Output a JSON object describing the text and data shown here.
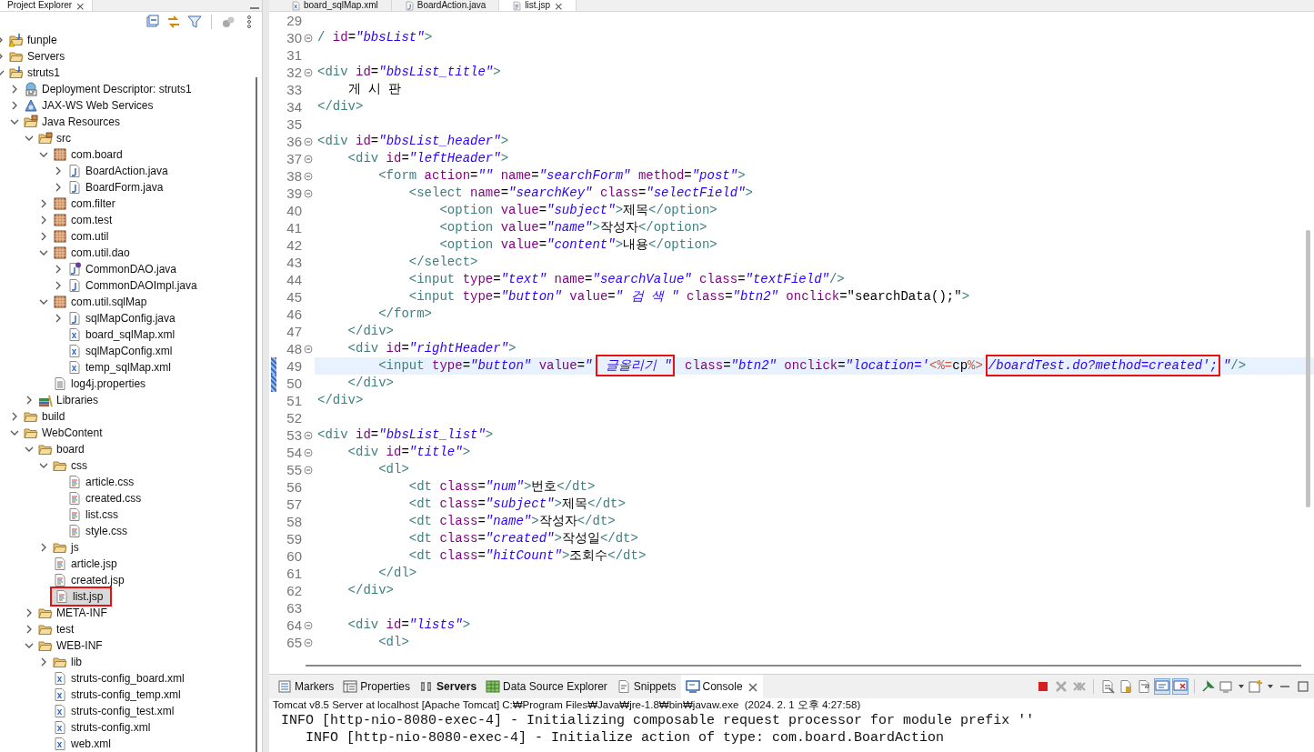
{
  "explorer": {
    "tab": {
      "label": "Project Explorer",
      "selected": true
    },
    "tree": [
      {
        "label": "funple",
        "kind": "project-warn",
        "expanded": false,
        "selected": false
      },
      {
        "label": "Servers",
        "kind": "folder",
        "expanded": false,
        "selected": false
      },
      {
        "label": "struts1",
        "kind": "project",
        "expanded": true,
        "selected": false,
        "children": [
          {
            "label": "Deployment Descriptor: struts1",
            "kind": "descriptor",
            "expanded": false,
            "selected": false
          },
          {
            "label": "JAX-WS Web Services",
            "kind": "webservice",
            "expanded": false,
            "selected": false
          },
          {
            "label": "Java Resources",
            "kind": "resources",
            "expanded": true,
            "selected": false,
            "children": [
              {
                "label": "src",
                "kind": "srcfolder",
                "expanded": true,
                "selected": false,
                "children": [
                  {
                    "label": "com.board",
                    "kind": "package",
                    "expanded": true,
                    "selected": false,
                    "children": [
                      {
                        "label": "BoardAction.java",
                        "kind": "java",
                        "expanded": false,
                        "selected": false
                      },
                      {
                        "label": "BoardForm.java",
                        "kind": "java",
                        "expanded": false,
                        "selected": false
                      }
                    ]
                  },
                  {
                    "label": "com.filter",
                    "kind": "package",
                    "expanded": false,
                    "selected": false
                  },
                  {
                    "label": "com.test",
                    "kind": "package",
                    "expanded": false,
                    "selected": false
                  },
                  {
                    "label": "com.util",
                    "kind": "package",
                    "expanded": false,
                    "selected": false
                  },
                  {
                    "label": "com.util.dao",
                    "kind": "package",
                    "expanded": true,
                    "selected": false,
                    "children": [
                      {
                        "label": "CommonDAO.java",
                        "kind": "interface",
                        "expanded": false,
                        "selected": false
                      },
                      {
                        "label": "CommonDAOImpl.java",
                        "kind": "java",
                        "expanded": false,
                        "selected": false
                      }
                    ]
                  },
                  {
                    "label": "com.util.sqlMap",
                    "kind": "package",
                    "expanded": true,
                    "selected": false,
                    "children": [
                      {
                        "label": "sqlMapConfig.java",
                        "kind": "java",
                        "expanded": false,
                        "selected": false
                      },
                      {
                        "label": "board_sqlMap.xml",
                        "kind": "xml",
                        "selected": false
                      },
                      {
                        "label": "sqlMapConfig.xml",
                        "kind": "xml",
                        "selected": false
                      },
                      {
                        "label": "temp_sqlMap.xml",
                        "kind": "xml",
                        "selected": false
                      }
                    ]
                  },
                  {
                    "label": "log4j.properties",
                    "kind": "text",
                    "selected": false
                  }
                ]
              },
              {
                "label": "Libraries",
                "kind": "library",
                "expanded": false,
                "selected": false
              }
            ]
          },
          {
            "label": "build",
            "kind": "folder",
            "expanded": false,
            "selected": false
          },
          {
            "label": "WebContent",
            "kind": "folder",
            "expanded": true,
            "selected": false,
            "children": [
              {
                "label": "board",
                "kind": "folder",
                "expanded": true,
                "selected": false,
                "children": [
                  {
                    "label": "css",
                    "kind": "folder",
                    "expanded": true,
                    "selected": false,
                    "children": [
                      {
                        "label": "article.css",
                        "kind": "web",
                        "selected": false
                      },
                      {
                        "label": "created.css",
                        "kind": "web",
                        "selected": false
                      },
                      {
                        "label": "list.css",
                        "kind": "web",
                        "selected": false
                      },
                      {
                        "label": "style.css",
                        "kind": "web",
                        "selected": false
                      }
                    ]
                  },
                  {
                    "label": "js",
                    "kind": "folder",
                    "expanded": false,
                    "selected": false
                  },
                  {
                    "label": "article.jsp",
                    "kind": "web",
                    "selected": false
                  },
                  {
                    "label": "created.jsp",
                    "kind": "web",
                    "selected": false
                  },
                  {
                    "label": "list.jsp",
                    "kind": "web",
                    "selected": true,
                    "boxed": true
                  }
                ]
              },
              {
                "label": "META-INF",
                "kind": "folder",
                "expanded": false,
                "selected": false
              },
              {
                "label": "test",
                "kind": "folder",
                "expanded": false,
                "selected": false
              },
              {
                "label": "WEB-INF",
                "kind": "folder",
                "expanded": true,
                "selected": false,
                "children": [
                  {
                    "label": "lib",
                    "kind": "folder",
                    "expanded": false,
                    "selected": false
                  },
                  {
                    "label": "struts-config_board.xml",
                    "kind": "xml",
                    "selected": false
                  },
                  {
                    "label": "struts-config_temp.xml",
                    "kind": "xml",
                    "selected": false
                  },
                  {
                    "label": "struts-config_test.xml",
                    "kind": "xml",
                    "selected": false
                  },
                  {
                    "label": "struts-config.xml",
                    "kind": "xml",
                    "selected": false
                  },
                  {
                    "label": "web.xml",
                    "kind": "xml",
                    "selected": false
                  }
                ]
              }
            ]
          }
        ]
      }
    ]
  },
  "editor": {
    "tabs": [
      {
        "label": "board_sqlMap.xml",
        "kind": "xml",
        "selected": false
      },
      {
        "label": "BoardAction.java",
        "kind": "java",
        "selected": false
      },
      {
        "label": "list.jsp",
        "kind": "web",
        "selected": true
      }
    ],
    "lines": [
      {
        "number": "29",
        "fold": false,
        "current": false,
        "changed": false
      },
      {
        "number": "30",
        "fold": true,
        "current": false,
        "changed": false,
        "tokens": [
          {
            "kind": "tag",
            "text": "/"
          },
          {
            "kind": "attr",
            "text": " id"
          },
          {
            "kind": "eq",
            "text": "="
          },
          {
            "kind": "value",
            "text": "\"bbsList\""
          },
          {
            "kind": "tag",
            "text": ">"
          }
        ]
      },
      {
        "number": "31",
        "fold": false,
        "current": false,
        "changed": false
      },
      {
        "number": "32",
        "fold": true,
        "current": false,
        "changed": false,
        "tokens": [
          {
            "kind": "tag",
            "text": "<div"
          },
          {
            "kind": "attr",
            "text": " id"
          },
          {
            "kind": "eq",
            "text": "="
          },
          {
            "kind": "value",
            "text": "\"bbsList_title\""
          },
          {
            "kind": "tag",
            "text": ">"
          }
        ]
      },
      {
        "number": "33",
        "fold": false,
        "current": false,
        "changed": false,
        "tokens": [
          {
            "kind": "text",
            "text": "    게 시 판"
          }
        ]
      },
      {
        "number": "34",
        "fold": false,
        "current": false,
        "changed": false,
        "tokens": [
          {
            "kind": "tag",
            "text": "</div>"
          }
        ]
      },
      {
        "number": "35",
        "fold": false,
        "current": false,
        "changed": false
      },
      {
        "number": "36",
        "fold": true,
        "current": false,
        "changed": false,
        "tokens": [
          {
            "kind": "tag",
            "text": "<div"
          },
          {
            "kind": "attr",
            "text": " id"
          },
          {
            "kind": "eq",
            "text": "="
          },
          {
            "kind": "value",
            "text": "\"bbsList_header\""
          },
          {
            "kind": "tag",
            "text": ">"
          }
        ]
      },
      {
        "number": "37",
        "fold": true,
        "current": false,
        "changed": false,
        "tokens": [
          {
            "kind": "tag",
            "text": "    <div"
          },
          {
            "kind": "attr",
            "text": " id"
          },
          {
            "kind": "eq",
            "text": "="
          },
          {
            "kind": "value",
            "text": "\"leftHeader\""
          },
          {
            "kind": "tag",
            "text": ">"
          }
        ]
      },
      {
        "number": "38",
        "fold": true,
        "current": false,
        "changed": false,
        "tokens": [
          {
            "kind": "tag",
            "text": "        <form"
          },
          {
            "kind": "attr",
            "text": " action"
          },
          {
            "kind": "eq",
            "text": "="
          },
          {
            "kind": "value",
            "text": "\"\""
          },
          {
            "kind": "attr",
            "text": " name"
          },
          {
            "kind": "eq",
            "text": "="
          },
          {
            "kind": "value",
            "text": "\"searchForm\""
          },
          {
            "kind": "attr",
            "text": " method"
          },
          {
            "kind": "eq",
            "text": "="
          },
          {
            "kind": "value",
            "text": "\"post\""
          },
          {
            "kind": "tag",
            "text": ">"
          }
        ]
      },
      {
        "number": "39",
        "fold": true,
        "current": false,
        "changed": false,
        "tokens": [
          {
            "kind": "tag",
            "text": "            <select"
          },
          {
            "kind": "attr",
            "text": " name"
          },
          {
            "kind": "eq",
            "text": "="
          },
          {
            "kind": "value",
            "text": "\"searchKey\""
          },
          {
            "kind": "attr",
            "text": " class"
          },
          {
            "kind": "eq",
            "text": "="
          },
          {
            "kind": "value",
            "text": "\"selectField\""
          },
          {
            "kind": "tag",
            "text": ">"
          }
        ]
      },
      {
        "number": "40",
        "fold": false,
        "current": false,
        "changed": false,
        "tokens": [
          {
            "kind": "tag",
            "text": "                <option"
          },
          {
            "kind": "attr",
            "text": " value"
          },
          {
            "kind": "eq",
            "text": "="
          },
          {
            "kind": "value",
            "text": "\"subject\""
          },
          {
            "kind": "tag",
            "text": ">"
          },
          {
            "kind": "text",
            "text": "제목"
          },
          {
            "kind": "tag",
            "text": "</option>"
          }
        ]
      },
      {
        "number": "41",
        "fold": false,
        "current": false,
        "changed": false,
        "tokens": [
          {
            "kind": "tag",
            "text": "                <option"
          },
          {
            "kind": "attr",
            "text": " value"
          },
          {
            "kind": "eq",
            "text": "="
          },
          {
            "kind": "value",
            "text": "\"name\""
          },
          {
            "kind": "tag",
            "text": ">"
          },
          {
            "kind": "text",
            "text": "작성자"
          },
          {
            "kind": "tag",
            "text": "</option>"
          }
        ]
      },
      {
        "number": "42",
        "fold": false,
        "current": false,
        "changed": false,
        "tokens": [
          {
            "kind": "tag",
            "text": "                <option"
          },
          {
            "kind": "attr",
            "text": " value"
          },
          {
            "kind": "eq",
            "text": "="
          },
          {
            "kind": "value",
            "text": "\"content\""
          },
          {
            "kind": "tag",
            "text": ">"
          },
          {
            "kind": "text",
            "text": "내용"
          },
          {
            "kind": "tag",
            "text": "</option>"
          }
        ]
      },
      {
        "number": "43",
        "fold": false,
        "current": false,
        "changed": false,
        "tokens": [
          {
            "kind": "tag",
            "text": "            </select>"
          }
        ]
      },
      {
        "number": "44",
        "fold": false,
        "current": false,
        "changed": false,
        "tokens": [
          {
            "kind": "tag",
            "text": "            <input"
          },
          {
            "kind": "attr",
            "text": " type"
          },
          {
            "kind": "eq",
            "text": "="
          },
          {
            "kind": "value",
            "text": "\"text\""
          },
          {
            "kind": "attr",
            "text": " name"
          },
          {
            "kind": "eq",
            "text": "="
          },
          {
            "kind": "value",
            "text": "\"searchValue\""
          },
          {
            "kind": "attr",
            "text": " class"
          },
          {
            "kind": "eq",
            "text": "="
          },
          {
            "kind": "value",
            "text": "\"textField\""
          },
          {
            "kind": "tag",
            "text": "/>"
          }
        ]
      },
      {
        "number": "45",
        "fold": false,
        "current": false,
        "changed": false,
        "tokens": [
          {
            "kind": "tag",
            "text": "            <input"
          },
          {
            "kind": "attr",
            "text": " type"
          },
          {
            "kind": "eq",
            "text": "="
          },
          {
            "kind": "value",
            "text": "\"button\""
          },
          {
            "kind": "attr",
            "text": " value"
          },
          {
            "kind": "eq",
            "text": "="
          },
          {
            "kind": "value",
            "text": "\" 검 색 \""
          },
          {
            "kind": "attr",
            "text": " class"
          },
          {
            "kind": "eq",
            "text": "="
          },
          {
            "kind": "value",
            "text": "\"btn2\""
          },
          {
            "kind": "attr",
            "text": " onclick"
          },
          {
            "kind": "eq",
            "text": "="
          },
          {
            "kind": "script",
            "text": "\"searchData();\""
          },
          {
            "kind": "tag",
            "text": ">"
          }
        ]
      },
      {
        "number": "46",
        "fold": false,
        "current": false,
        "changed": false,
        "tokens": [
          {
            "kind": "tag",
            "text": "        </form>"
          }
        ]
      },
      {
        "number": "47",
        "fold": false,
        "current": false,
        "changed": false,
        "tokens": [
          {
            "kind": "tag",
            "text": "    </div>"
          }
        ]
      },
      {
        "number": "48",
        "fold": true,
        "current": false,
        "changed": false,
        "tokens": [
          {
            "kind": "tag",
            "text": "    <div"
          },
          {
            "kind": "attr",
            "text": " id"
          },
          {
            "kind": "eq",
            "text": "="
          },
          {
            "kind": "value",
            "text": "\"rightHeader\""
          },
          {
            "kind": "tag",
            "text": ">"
          }
        ]
      },
      {
        "number": "49",
        "fold": false,
        "current": true,
        "changed": true,
        "tokens": [
          {
            "kind": "tag",
            "text": "        <input"
          },
          {
            "kind": "attr",
            "text": " type"
          },
          {
            "kind": "eq",
            "text": "="
          },
          {
            "kind": "value",
            "text": "\"button\""
          },
          {
            "kind": "attr",
            "text": " value"
          },
          {
            "kind": "eq",
            "text": "="
          },
          {
            "kind": "value",
            "text": "\""
          },
          {
            "kind": "value",
            "text": " 글올리기 \"",
            "boxed": true
          },
          {
            "kind": "attr",
            "text": " class"
          },
          {
            "kind": "eq",
            "text": "="
          },
          {
            "kind": "value",
            "text": "\"btn2\""
          },
          {
            "kind": "attr",
            "text": " onclick"
          },
          {
            "kind": "eq",
            "text": "="
          },
          {
            "kind": "value",
            "text": "\"location='"
          },
          {
            "kind": "jsp",
            "text": "<%="
          },
          {
            "kind": "text",
            "text": "cp"
          },
          {
            "kind": "jsp",
            "text": "%>"
          },
          {
            "kind": "value",
            "text": "/boardTest.do?method=created';",
            "boxed": true
          },
          {
            "kind": "value",
            "text": "\""
          },
          {
            "kind": "tag",
            "text": "/>"
          }
        ]
      },
      {
        "number": "50",
        "fold": false,
        "current": false,
        "changed": true,
        "tokens": [
          {
            "kind": "tag",
            "text": "    </div>"
          }
        ]
      },
      {
        "number": "51",
        "fold": false,
        "current": false,
        "changed": false,
        "tokens": [
          {
            "kind": "tag",
            "text": "</div>"
          }
        ]
      },
      {
        "number": "52",
        "fold": false,
        "current": false,
        "changed": false
      },
      {
        "number": "53",
        "fold": true,
        "current": false,
        "changed": false,
        "tokens": [
          {
            "kind": "tag",
            "text": "<div"
          },
          {
            "kind": "attr",
            "text": " id"
          },
          {
            "kind": "eq",
            "text": "="
          },
          {
            "kind": "value",
            "text": "\"bbsList_list\""
          },
          {
            "kind": "tag",
            "text": ">"
          }
        ]
      },
      {
        "number": "54",
        "fold": true,
        "current": false,
        "changed": false,
        "tokens": [
          {
            "kind": "tag",
            "text": "    <div"
          },
          {
            "kind": "attr",
            "text": " id"
          },
          {
            "kind": "eq",
            "text": "="
          },
          {
            "kind": "value",
            "text": "\"title\""
          },
          {
            "kind": "tag",
            "text": ">"
          }
        ]
      },
      {
        "number": "55",
        "fold": true,
        "current": false,
        "changed": false,
        "tokens": [
          {
            "kind": "tag",
            "text": "        <dl>"
          }
        ]
      },
      {
        "number": "56",
        "fold": false,
        "current": false,
        "changed": false,
        "tokens": [
          {
            "kind": "tag",
            "text": "            <dt"
          },
          {
            "kind": "attr",
            "text": " class"
          },
          {
            "kind": "eq",
            "text": "="
          },
          {
            "kind": "value",
            "text": "\"num\""
          },
          {
            "kind": "tag",
            "text": ">"
          },
          {
            "kind": "text",
            "text": "번호"
          },
          {
            "kind": "tag",
            "text": "</dt>"
          }
        ]
      },
      {
        "number": "57",
        "fold": false,
        "current": false,
        "changed": false,
        "tokens": [
          {
            "kind": "tag",
            "text": "            <dt"
          },
          {
            "kind": "attr",
            "text": " class"
          },
          {
            "kind": "eq",
            "text": "="
          },
          {
            "kind": "value",
            "text": "\"subject\""
          },
          {
            "kind": "tag",
            "text": ">"
          },
          {
            "kind": "text",
            "text": "제목"
          },
          {
            "kind": "tag",
            "text": "</dt>"
          }
        ]
      },
      {
        "number": "58",
        "fold": false,
        "current": false,
        "changed": false,
        "tokens": [
          {
            "kind": "tag",
            "text": "            <dt"
          },
          {
            "kind": "attr",
            "text": " class"
          },
          {
            "kind": "eq",
            "text": "="
          },
          {
            "kind": "value",
            "text": "\"name\""
          },
          {
            "kind": "tag",
            "text": ">"
          },
          {
            "kind": "text",
            "text": "작성자"
          },
          {
            "kind": "tag",
            "text": "</dt>"
          }
        ]
      },
      {
        "number": "59",
        "fold": false,
        "current": false,
        "changed": false,
        "tokens": [
          {
            "kind": "tag",
            "text": "            <dt"
          },
          {
            "kind": "attr",
            "text": " class"
          },
          {
            "kind": "eq",
            "text": "="
          },
          {
            "kind": "value",
            "text": "\"created\""
          },
          {
            "kind": "tag",
            "text": ">"
          },
          {
            "kind": "text",
            "text": "작성일"
          },
          {
            "kind": "tag",
            "text": "</dt>"
          }
        ]
      },
      {
        "number": "60",
        "fold": false,
        "current": false,
        "changed": false,
        "tokens": [
          {
            "kind": "tag",
            "text": "            <dt"
          },
          {
            "kind": "attr",
            "text": " class"
          },
          {
            "kind": "eq",
            "text": "="
          },
          {
            "kind": "value",
            "text": "\"hitCount\""
          },
          {
            "kind": "tag",
            "text": ">"
          },
          {
            "kind": "text",
            "text": "조회수"
          },
          {
            "kind": "tag",
            "text": "</dt>"
          }
        ]
      },
      {
        "number": "61",
        "fold": false,
        "current": false,
        "changed": false,
        "tokens": [
          {
            "kind": "tag",
            "text": "        </dl>"
          }
        ]
      },
      {
        "number": "62",
        "fold": false,
        "current": false,
        "changed": false,
        "tokens": [
          {
            "kind": "tag",
            "text": "    </div>"
          }
        ]
      },
      {
        "number": "63",
        "fold": false,
        "current": false,
        "changed": false
      },
      {
        "number": "64",
        "fold": true,
        "current": false,
        "changed": false,
        "tokens": [
          {
            "kind": "tag",
            "text": "    <div"
          },
          {
            "kind": "attr",
            "text": " id"
          },
          {
            "kind": "eq",
            "text": "="
          },
          {
            "kind": "value",
            "text": "\"lists\""
          },
          {
            "kind": "tag",
            "text": ">"
          }
        ]
      },
      {
        "number": "65",
        "fold": true,
        "current": false,
        "changed": false,
        "tokens": [
          {
            "kind": "tag",
            "text": "        <dl>"
          }
        ]
      }
    ]
  },
  "bottom_panel": {
    "tabs": [
      {
        "label": "Markers",
        "kind": "markers",
        "selected": false,
        "bold": false
      },
      {
        "label": "Properties",
        "kind": "properties",
        "selected": false,
        "bold": false
      },
      {
        "label": "Servers",
        "kind": "servers",
        "selected": false,
        "bold": true
      },
      {
        "label": "Data Source Explorer",
        "kind": "datasource",
        "selected": false,
        "bold": false
      },
      {
        "label": "Snippets",
        "kind": "snippets",
        "selected": false,
        "bold": false
      },
      {
        "label": "Console",
        "kind": "console",
        "selected": true,
        "bold": false
      }
    ],
    "console_title": "Tomcat v8.5 Server at localhost [Apache Tomcat] C:₩Program Files₩Java₩jre-1.8₩bin₩javaw.exe  (2024. 2. 1 오후 4:27:58)",
    "console_lines": [
      " INFO [http-nio-8080-exec-4] - Initializing composable request processor for module prefix ''",
      "    INFO [http-nio-8080-exec-4] - Initialize action of type: com.board.BoardAction"
    ]
  }
}
